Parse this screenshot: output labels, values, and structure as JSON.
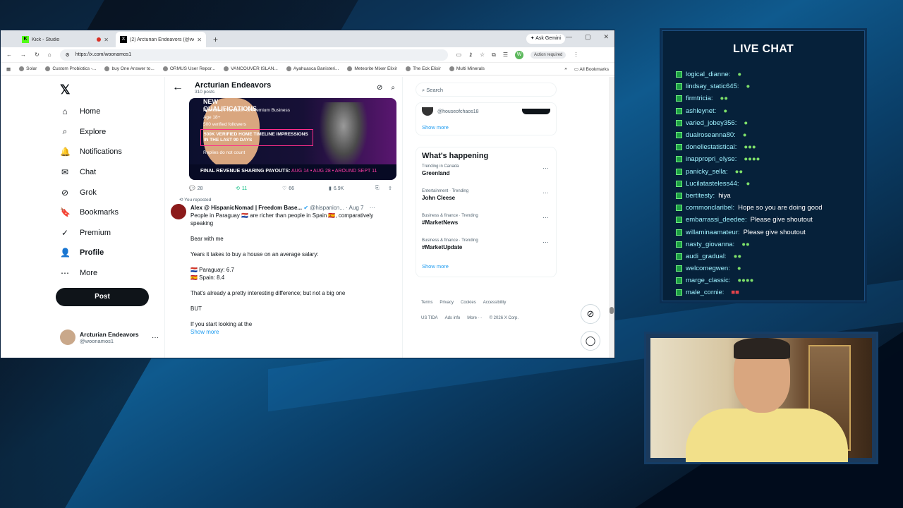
{
  "browser": {
    "tabs": [
      {
        "title": "Kick - Studio",
        "active": false
      },
      {
        "title": "(2) Arcturian Endeavors (@woo",
        "active": true
      }
    ],
    "ask_gemini": "Ask Gemini",
    "url": "https://x.com/woonamos1",
    "action_required": "Action required",
    "bookmarks": [
      "Solar",
      "Custom Probiotics -...",
      "buy One Answer to...",
      "ORMUS User Repor...",
      "VANCOUVER ISLAN...",
      "Ayahuasca Banisteri...",
      "Meteorite Mixer Elixir",
      "The Eck Elixir",
      "Multi Minerals"
    ],
    "all_bookmarks": "All Bookmarks"
  },
  "nav": {
    "items": [
      {
        "label": "Home",
        "icon": "home-icon",
        "glyph": "⌂"
      },
      {
        "label": "Explore",
        "icon": "search-icon",
        "glyph": "⌕"
      },
      {
        "label": "Notifications",
        "icon": "bell-icon",
        "glyph": "🔔"
      },
      {
        "label": "Chat",
        "icon": "chat-icon",
        "glyph": "✉"
      },
      {
        "label": "Grok",
        "icon": "grok-icon",
        "glyph": "⊘"
      },
      {
        "label": "Bookmarks",
        "icon": "bookmark-icon",
        "glyph": "🔖"
      },
      {
        "label": "Premium",
        "icon": "premium-icon",
        "glyph": "✓"
      },
      {
        "label": "Profile",
        "icon": "profile-icon",
        "glyph": "👤"
      },
      {
        "label": "More",
        "icon": "more-icon",
        "glyph": "⋯"
      }
    ],
    "post": "Post",
    "account_name": "Arcturian Endeavors",
    "account_handle": "@woonamos1"
  },
  "feed": {
    "profile_name": "Arcturian Endeavors",
    "post_count": "310 posts",
    "card": {
      "heading": "NEW QUALIFICATIONS",
      "req1": "Premium, Premium+ or Premium Business",
      "req2": "Age 18+",
      "req3": "500 verified followers",
      "box": "500K VERIFIED HOME TIMELINE IMPRESSIONS IN THE LAST 90 DAYS",
      "req4": "Replies do not count",
      "payout_label": "FINAL REVENUE SHARING PAYOUTS:",
      "payout_dates": "AUG 14 • AUG 28 • AROUND SEPT 11"
    },
    "actions": {
      "replies": "28",
      "reposts": "11",
      "likes": "66",
      "views": "6.9K"
    },
    "repost_label": "You reposted",
    "tweet": {
      "author": "Alex @ HispanicNomad | Freedom Base...",
      "handle": "@hispanicn...",
      "date": "· Aug 7",
      "lines": [
        "People in Paraguay 🇵🇾 are richer than people in Spain 🇪🇸, comparatively speaking",
        "Bear with me",
        "Years it takes to buy a house on an average salary:",
        "🇵🇾 Paraguay: 6.7\n🇪🇸 Spain: 8.4",
        "That's already a pretty interesting difference; but not a big one",
        "BUT",
        "If you start looking at the"
      ],
      "show_more": "Show more"
    }
  },
  "right": {
    "search_placeholder": "Search",
    "who_handle": "@houseofchaos18",
    "show_more": "Show more",
    "whats_happening": "What's happening",
    "trends": [
      {
        "meta": "Trending in Canada",
        "name": "Greenland"
      },
      {
        "meta": "Entertainment · Trending",
        "name": "John Cleese"
      },
      {
        "meta": "Business & finance · Trending",
        "name": "#MarketNews"
      },
      {
        "meta": "Business & finance · Trending",
        "name": "#MarketUpdate"
      }
    ],
    "show_more2": "Show more",
    "footer": [
      "Terms",
      "Privacy",
      "Cookies",
      "Accessibility",
      "US TIDA",
      "Ads info",
      "More ···",
      "© 2026 X Corp."
    ]
  },
  "chat": {
    "title": "LIVE CHAT",
    "messages": [
      {
        "user": "logical_dianne:",
        "text": "",
        "emote": "●"
      },
      {
        "user": "lindsay_static645:",
        "text": "",
        "emote": "●"
      },
      {
        "user": "firmtricia:",
        "text": "",
        "emote": "●●"
      },
      {
        "user": "ashleynet:",
        "text": "",
        "emote": "●"
      },
      {
        "user": "varied_jobey356:",
        "text": "",
        "emote": "●"
      },
      {
        "user": "dualroseanna80:",
        "text": "",
        "emote": "●"
      },
      {
        "user": "donellestatistical:",
        "text": "",
        "emote": "●●●"
      },
      {
        "user": "inappropri_elyse:",
        "text": "",
        "emote": "●●●●"
      },
      {
        "user": "panicky_sella:",
        "text": "",
        "emote": "●●"
      },
      {
        "user": "Lucilatasteless44:",
        "text": "",
        "emote": "●"
      },
      {
        "user": "bertitesty:",
        "text": "hiya",
        "emote": ""
      },
      {
        "user": "commonclaribel:",
        "text": "Hope so you are doing good",
        "emote": ""
      },
      {
        "user": "embarrassi_deedee:",
        "text": "Please give shoutout",
        "emote": ""
      },
      {
        "user": "willaminaamateur:",
        "text": "Please give shoutout",
        "emote": ""
      },
      {
        "user": "nasty_giovanna:",
        "text": "",
        "emote": "●●"
      },
      {
        "user": "audi_gradual:",
        "text": "",
        "emote": "●●"
      },
      {
        "user": "welcomegwen:",
        "text": "",
        "emote": "●"
      },
      {
        "user": "marge_classic:",
        "text": "",
        "emote": "●●●●"
      },
      {
        "user": "male_cornie:",
        "text": "",
        "emote": "■■"
      }
    ]
  },
  "colors": {
    "chat_user": "#9ff2ff",
    "x_blue": "#1d9bf0",
    "repost_green": "#00ba7c"
  }
}
